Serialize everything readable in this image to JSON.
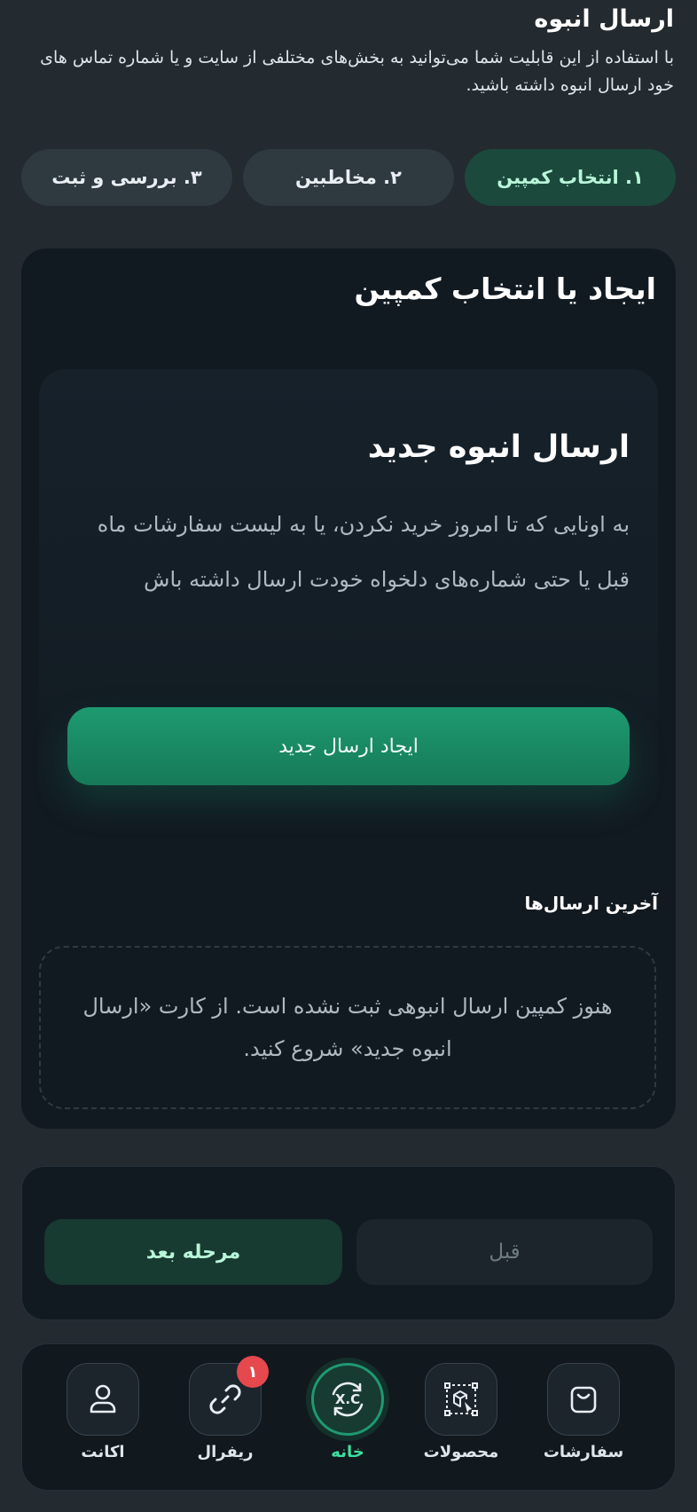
{
  "header": {
    "title": "ارسال انبوه",
    "description": "با استفاده از این قابلیت شما می‌توانید به بخش‌های مختلفی از سایت و یا شماره تماس های خود ارسال انبوه داشته باشید."
  },
  "steps": [
    {
      "label": "۱. انتخاب کمپین",
      "active": true
    },
    {
      "label": "۲. مخاطبین",
      "active": false
    },
    {
      "label": "۳. بررسی و ثبت",
      "active": false
    }
  ],
  "main": {
    "title": "ایجاد یا انتخاب کمپین",
    "new_send": {
      "title": "ارسال انبوه جدید",
      "description": "به اونایی که تا امروز خرید نکردن، یا به لیست سفارشات ماه قبل یا حتی شماره‌های دلخواه خودت ارسال داشته باش",
      "button": "ایجاد ارسال جدید"
    },
    "recent": {
      "title": "آخرین ارسال‌ها",
      "empty": "هنوز کمپین ارسال انبوهی ثبت نشده است. از کارت «ارسال انبوه جدید» شروع کنید."
    }
  },
  "nav": {
    "prev": "قبل",
    "next": "مرحله بعد"
  },
  "tabbar": {
    "orders": "سفارشات",
    "products": "محصولات",
    "home": "خانه",
    "referral": "ریفرال",
    "referral_badge": "۱",
    "account": "اکانت",
    "home_icon_text": "X.C"
  },
  "colors": {
    "accent": "#1e9a70",
    "accent_text": "#3de0a0",
    "badge": "#e5484d",
    "background": "#232a30",
    "card": "#121a21"
  }
}
